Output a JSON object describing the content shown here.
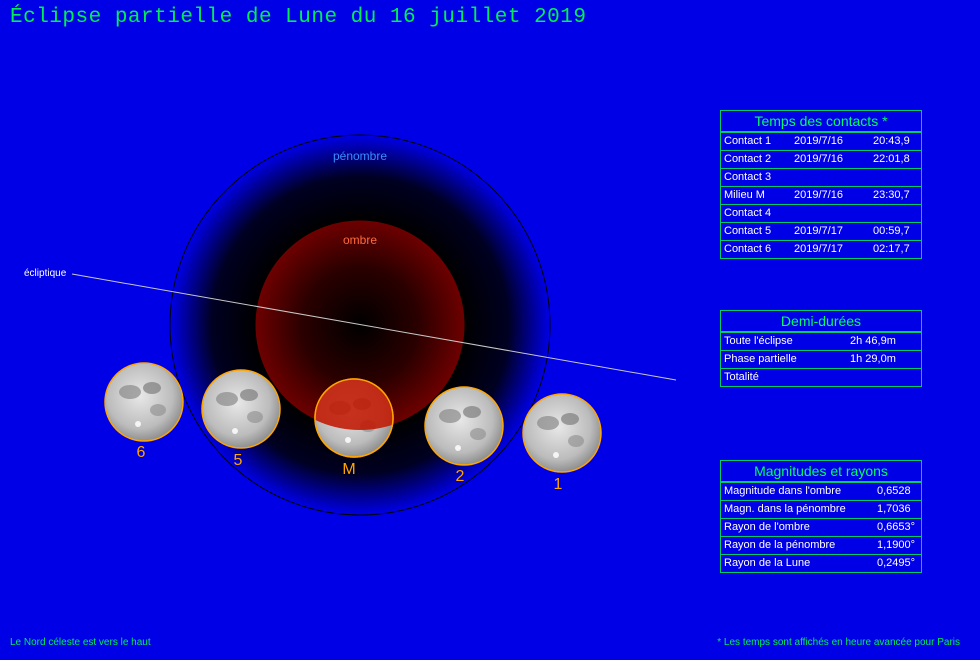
{
  "title": "Éclipse partielle de Lune du 16 juillet 2019",
  "diagram": {
    "penumbra_label": "pénombre",
    "umbra_label": "ombre",
    "ecliptic_label": "écliptique",
    "moons": [
      {
        "label": "6"
      },
      {
        "label": "5"
      },
      {
        "label": "M"
      },
      {
        "label": "2"
      },
      {
        "label": "1"
      }
    ]
  },
  "contacts": {
    "heading": "Temps des contacts *",
    "rows": [
      {
        "name": "Contact 1",
        "date": "2019/7/16",
        "time": "20:43,9"
      },
      {
        "name": "Contact 2",
        "date": "2019/7/16",
        "time": "22:01,8"
      },
      {
        "name": "Contact 3",
        "date": "",
        "time": ""
      },
      {
        "name": "Milieu M",
        "date": "2019/7/16",
        "time": "23:30,7"
      },
      {
        "name": "Contact 4",
        "date": "",
        "time": ""
      },
      {
        "name": "Contact 5",
        "date": "2019/7/17",
        "time": "00:59,7"
      },
      {
        "name": "Contact 6",
        "date": "2019/7/17",
        "time": "02:17,7"
      }
    ]
  },
  "durations": {
    "heading": "Demi-durées",
    "rows": [
      {
        "name": "Toute l'éclipse",
        "value": "2h 46,9m"
      },
      {
        "name": "Phase partielle",
        "value": "1h 29,0m"
      },
      {
        "name": "Totalité",
        "value": ""
      }
    ]
  },
  "magnitudes": {
    "heading": "Magnitudes et rayons",
    "rows": [
      {
        "name": "Magnitude dans l'ombre",
        "value": "0,6528"
      },
      {
        "name": "Magn. dans la pénombre",
        "value": "1,7036"
      },
      {
        "name": "Rayon de l'ombre",
        "value": "0,6653°"
      },
      {
        "name": "Rayon de la pénombre",
        "value": "1,1900°"
      },
      {
        "name": "Rayon de la Lune",
        "value": "0,2495°"
      }
    ]
  },
  "footer": {
    "left": "Le Nord céleste est vers le haut",
    "right": "* Les temps sont affichés en heure avancée pour Paris"
  },
  "colors": {
    "background": "#0000e6",
    "text_green": "#00ff66",
    "umbra": "#6b0000",
    "penumbra_label": "#3a8cff",
    "umbra_label": "#ff6a3a",
    "moon_outline": "#ffa500",
    "moon_label": "#ffa500",
    "moon_eclipsed": "#c01800"
  }
}
